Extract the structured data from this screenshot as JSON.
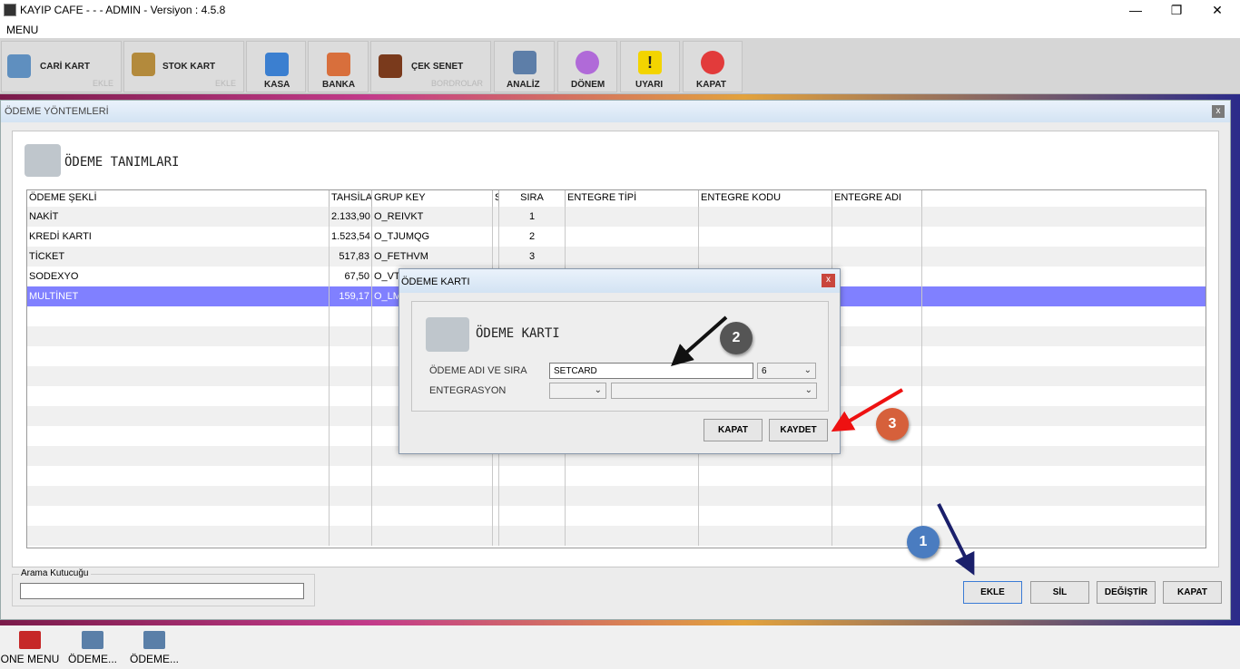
{
  "window": {
    "title": "KAYIP CAFE -  -  - ADMIN -  Versiyon : 4.5.8",
    "min": "—",
    "max": "❐",
    "close": "✕"
  },
  "menu": {
    "label": "MENU"
  },
  "toolbar": {
    "cari": {
      "label": "CARİ KART",
      "sub": "EKLE"
    },
    "stok": {
      "label": "STOK KART",
      "sub": "EKLE"
    },
    "kasa": "KASA",
    "banka": "BANKA",
    "cek": {
      "label": "ÇEK SENET",
      "sub": "BORDROLAR"
    },
    "analiz": "ANALİZ",
    "donem": "DÖNEM",
    "uyari": "UYARI",
    "kapat": "KAPAT"
  },
  "child": {
    "title": "ÖDEME YÖNTEMLERİ",
    "close": "x",
    "heading": "ÖDEME TANIMLARI"
  },
  "grid": {
    "headers": [
      "ÖDEME ŞEKLİ",
      "TAHSİLA",
      "GRUP KEY",
      "S",
      "SIRA",
      "ENTEGRE TİPİ",
      "ENTEGRE KODU",
      "ENTEGRE ADI"
    ],
    "rows": [
      [
        "NAKİT",
        "2.133,90",
        "O_REIVKT",
        "",
        "1",
        "",
        "",
        ""
      ],
      [
        "KREDİ KARTI",
        "1.523,54",
        "O_TJUMQG",
        "",
        "2",
        "",
        "",
        ""
      ],
      [
        "TİCKET",
        "517,83",
        "O_FETHVM",
        "",
        "3",
        "",
        "",
        ""
      ],
      [
        "SODEXYO",
        "67,50",
        "O_VTV",
        "",
        "",
        "",
        "",
        ""
      ],
      [
        "MULTİNET",
        "159,17",
        "O_LM",
        "",
        "",
        "",
        "",
        ""
      ]
    ]
  },
  "search": {
    "label": "Arama Kutucuğu",
    "value": ""
  },
  "buttons": {
    "ekle": "EKLE",
    "sil": "SİL",
    "degistir": "DEĞİŞTİR",
    "kapat": "KAPAT"
  },
  "dialog": {
    "title": "ÖDEME KARTI",
    "close": "x",
    "heading": "ÖDEME KARTI",
    "name_label": "ÖDEME ADI VE SIRA",
    "name_value": "SETCARD",
    "order_value": "6",
    "integ_label": "ENTEGRASYON",
    "integ_type": "",
    "integ_value": "",
    "kapat": "KAPAT",
    "kaydet": "KAYDET"
  },
  "annotations": {
    "one": "1",
    "two": "2",
    "three": "3"
  },
  "taskbar": [
    {
      "label": "ONE MENU"
    },
    {
      "label": "ÖDEME..."
    },
    {
      "label": "ÖDEME..."
    }
  ],
  "colors": {
    "selected_row": "#8080ff",
    "badge1": "#4a7cc0",
    "badge2": "#555555",
    "badge3": "#d6603b"
  }
}
